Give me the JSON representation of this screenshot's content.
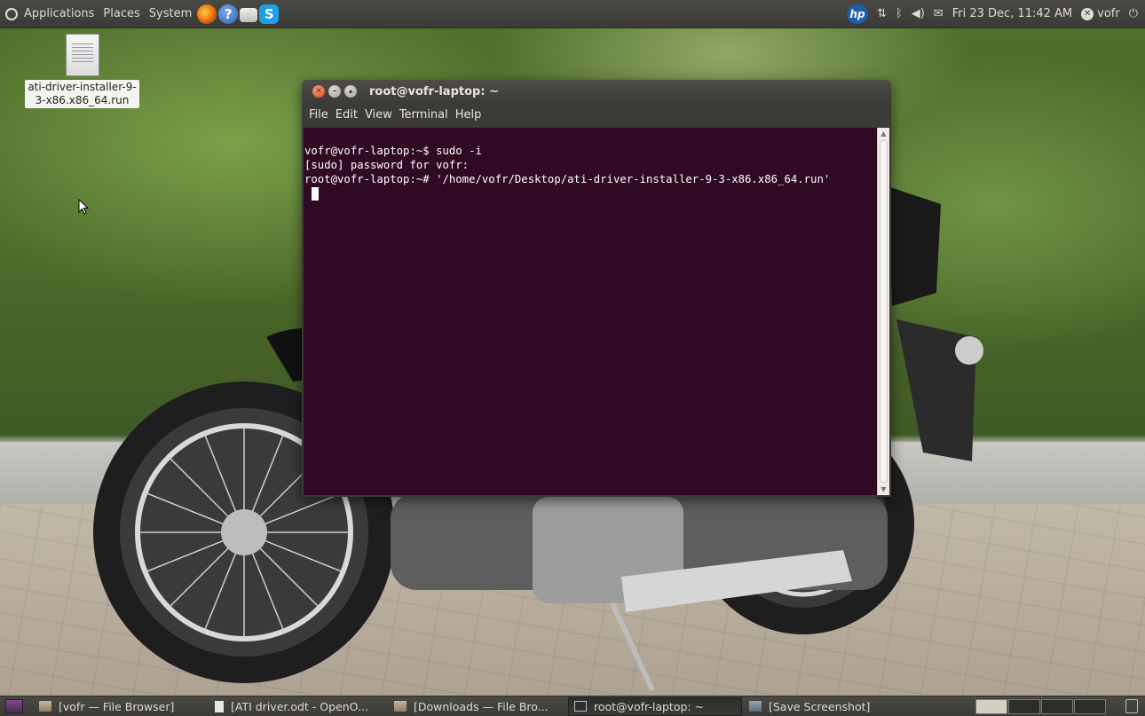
{
  "top_panel": {
    "menus": [
      "Applications",
      "Places",
      "System"
    ],
    "launchers": [
      "firefox-icon",
      "help-icon",
      "mail-icon",
      "skype-icon"
    ],
    "tray_hp": "hp",
    "clock": "Fri 23 Dec, 11:42 AM",
    "user": "vofr"
  },
  "desktop": {
    "icon_label_line1": "ati-driver-installer-9-",
    "icon_label_line2": "3-x86.x86_64.run"
  },
  "terminal": {
    "title": "root@vofr-laptop: ~",
    "menu": [
      "File",
      "Edit",
      "View",
      "Terminal",
      "Help"
    ],
    "lines": [
      "vofr@vofr-laptop:~$ sudo -i",
      "[sudo] password for vofr:",
      "root@vofr-laptop:~# '/home/vofr/Desktop/ati-driver-installer-9-3-x86.x86_64.run'"
    ],
    "colors": {
      "background": "#300a24",
      "text": "#ffffff"
    }
  },
  "taskbar": {
    "tasks": [
      "[vofr — File Browser]",
      "[ATI driver.odt - OpenO...",
      "[Downloads — File Bro...",
      "root@vofr-laptop: ~",
      "[Save Screenshot]"
    ]
  }
}
